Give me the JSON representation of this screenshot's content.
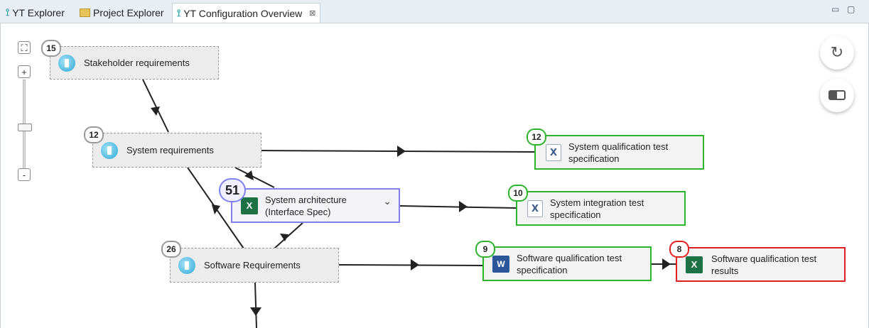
{
  "tabs": [
    {
      "label": "YT Explorer",
      "icon": "yt-icon"
    },
    {
      "label": "Project Explorer",
      "icon": "folder-icon"
    },
    {
      "label": "YT Configuration Overview",
      "icon": "yt-icon",
      "active": true
    }
  ],
  "window_controls": {
    "minimize": "▭",
    "maximize": "▢"
  },
  "zoom": {
    "fit": "⛶",
    "plus": "+",
    "minus": "-"
  },
  "toolbar": {
    "refresh_icon": "refresh-icon",
    "toggle_icon": "toggle-icon"
  },
  "nodes": {
    "stakeholder": {
      "label": "Stakeholder requirements",
      "count": "15",
      "icon": "requirements-icon"
    },
    "system_req": {
      "label": "System requirements",
      "count": "12",
      "icon": "requirements-icon"
    },
    "system_arch": {
      "label": "System architecture (Interface Spec)",
      "count": "51",
      "icon": "excel-icon"
    },
    "software_req": {
      "label": "Software Requirements",
      "count": "26",
      "icon": "requirements-icon"
    },
    "sys_qual_test": {
      "label": "System qualification test specification",
      "count": "12",
      "icon": "xml-doc-icon"
    },
    "sys_int_test": {
      "label": "System integration test specification",
      "count": "10",
      "icon": "xml-doc-icon"
    },
    "sw_qual_test": {
      "label": "Software qualification test specification",
      "count": "9",
      "icon": "word-icon"
    },
    "sw_qual_results": {
      "label": "Software qualification test results",
      "count": "8",
      "icon": "excel-icon"
    }
  },
  "colors": {
    "green": "#2cb52c",
    "red": "#e02020",
    "blue": "#8080ee",
    "dashed": "#9a9a9a"
  }
}
